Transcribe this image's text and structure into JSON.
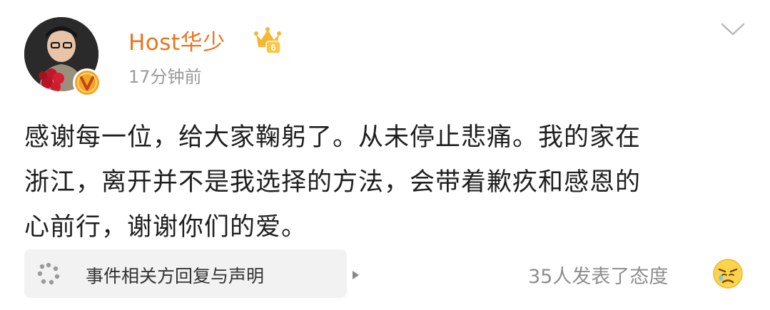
{
  "user": {
    "name": "Host华少",
    "avatar_icon": "user-avatar-photo",
    "verified_badge": "verified-v-badge-icon",
    "member_badge": {
      "icon": "crown-icon",
      "level": "6"
    }
  },
  "post": {
    "timestamp": "17分钟前",
    "lines": [
      "感谢每一位，给大家鞠躬了。从未停止悲痛。我的家在",
      "浙江，离开并不是我选择的方法，会带着歉疚和感恩的",
      "心前行，谢谢你们的爱。"
    ]
  },
  "topic_card": {
    "icon": "topic-dots-icon",
    "label": "事件相关方回复与声明",
    "arrow_icon": "triangle-right-icon"
  },
  "reactions": {
    "summary": "35人发表了态度",
    "emoji_icon": "sad-emoji-icon"
  },
  "menu": {
    "icon": "chevron-down-icon"
  },
  "colors": {
    "username": "#e9761b",
    "timestamp": "#9a9a9a",
    "body_text": "#1f1f1f",
    "card_bg": "#f2f2f2",
    "verified": "#f4a623"
  }
}
